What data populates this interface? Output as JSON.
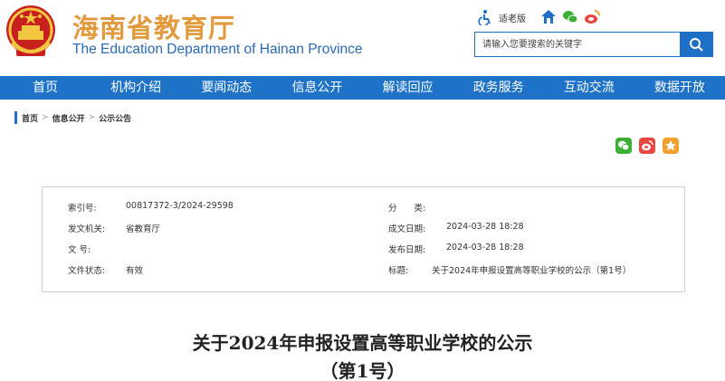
{
  "header": {
    "brand_cn": "海南省教育厅",
    "brand_en": "The Education Department of Hainan Province",
    "tools": {
      "elder_mode_label": "适老版"
    },
    "search": {
      "placeholder": "请输入您要搜索的关键字"
    }
  },
  "nav": {
    "items": [
      {
        "label": "首页"
      },
      {
        "label": "机构介绍"
      },
      {
        "label": "要闻动态"
      },
      {
        "label": "信息公开"
      },
      {
        "label": "解读回应"
      },
      {
        "label": "政务服务"
      },
      {
        "label": "互动交流"
      },
      {
        "label": "数据开放"
      }
    ]
  },
  "breadcrumb": {
    "items": [
      {
        "label": "首页"
      },
      {
        "label": "信息公开"
      },
      {
        "label": "公示公告"
      }
    ],
    "separator": ">"
  },
  "share": {
    "icons": [
      "wechat-icon",
      "weibo-icon",
      "favorite-icon"
    ],
    "colors": {
      "wechat": "#3cb035",
      "weibo": "#e6473f",
      "favorite": "#f0a130"
    }
  },
  "meta": {
    "index_no": {
      "label": "索引号:",
      "value": "00817372-3/2024-29598"
    },
    "category": {
      "label": "分　　类:",
      "value": ""
    },
    "issuer": {
      "label": "发文机关:",
      "value": "省教育厅"
    },
    "created_date": {
      "label": "成文日期:",
      "value": "2024-03-28 18:28"
    },
    "doc_no": {
      "label": "文 号:",
      "value": ""
    },
    "published_date": {
      "label": "发布日期:",
      "value": "2024-03-28 18:28"
    },
    "status": {
      "label": "文件状态:",
      "value": "有效"
    },
    "title": {
      "label": "标题:",
      "value": "关于2024年申报设置高等职业学校的公示（第1号）"
    }
  },
  "document": {
    "title": "关于2024年申报设置高等职业学校的公示",
    "subtitle": "（第1号）"
  },
  "colors": {
    "nav_bg": "#1e73c8",
    "brand_orange": "#e39a3c",
    "brand_blue": "#2a6bb8"
  }
}
